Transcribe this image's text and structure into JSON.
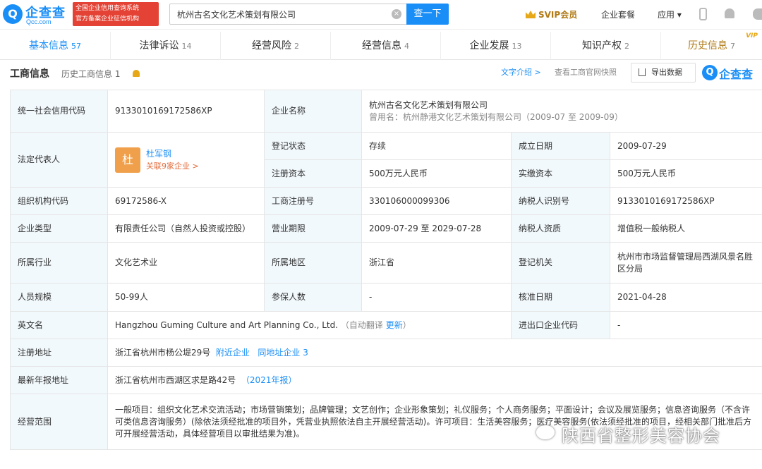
{
  "header": {
    "logo_glyph": "Q",
    "logo_text": "企查查",
    "logo_domain": "Qcc.com",
    "badge_line1": "全国企业信用查询系统",
    "badge_line2": "官方备案企业征信机构",
    "search_value": "杭州古名文化艺术策划有限公司",
    "clear_glyph": "×",
    "search_button": "查一下",
    "svip": "SVIP会员",
    "package": "企业套餐",
    "app": "应用 ▾"
  },
  "tabs": [
    {
      "label": "基本信息",
      "count": "57"
    },
    {
      "label": "法律诉讼",
      "count": "14"
    },
    {
      "label": "经营风险",
      "count": "2"
    },
    {
      "label": "经营信息",
      "count": "4"
    },
    {
      "label": "企业发展",
      "count": "13"
    },
    {
      "label": "知识产权",
      "count": "2"
    },
    {
      "label": "历史信息",
      "count": "7",
      "tag": "VIP"
    }
  ],
  "section": {
    "title": "工商信息",
    "history": "历史工商信息 1",
    "intro": "文字介绍 >",
    "gov": "查看工商官网快照",
    "export": "导出数据",
    "logo_text": "企查查"
  },
  "info": {
    "l_credit": "统一社会信用代码",
    "credit": "913301016917258­6XP",
    "l_name": "企业名称",
    "name": "杭州古名文化艺术策划有限公司",
    "former": "曾用名：杭州静港文化艺术策划有限公司（2009-07 至 2009-09）",
    "l_rep": "法定代表人",
    "rep_avatar": "杜",
    "rep_name": "杜军钢",
    "rep_link": "关联9家企业 >",
    "l_status": "登记状态",
    "status": "存续",
    "l_found": "成立日期",
    "found": "2009-07-29",
    "l_capital": "注册资本",
    "capital": "500万元人民币",
    "l_paid": "实缴资本",
    "paid": "500万元人民币",
    "l_org": "组织机构代码",
    "org": "69172586-X",
    "l_regno": "工商注册号",
    "regno": "330106000099306",
    "l_taxid": "纳税人识别号",
    "taxid": "91330101691725­86XP",
    "l_type": "企业类型",
    "type": "有限责任公司（自然人投资或控股）",
    "l_term": "营业期限",
    "term": "2009-07-29 至 2029-07-28",
    "l_taxq": "纳税人资质",
    "taxq": "增值税一般纳税人",
    "l_industry": "所属行业",
    "industry": "文化艺术业",
    "l_region": "所属地区",
    "region": "浙江省",
    "l_authority": "登记机关",
    "authority": "杭州市市场监督管理局西湖风景名胜区分局",
    "l_staff": "人员规模",
    "staff": "50-99人",
    "l_insured": "参保人数",
    "insured": "-",
    "l_approve": "核准日期",
    "approve": "2021-04-28",
    "l_en": "英文名",
    "en": "Hangzhou Guming Culture and Art Planning Co., Ltd.",
    "en_auto": "（自动翻译",
    "en_update": "更新",
    "en_close": "）",
    "l_impexp": "进出口企业代码",
    "impexp": "-",
    "l_addr": "注册地址",
    "addr": "浙江省杭州市杨公堤29号",
    "addr_near": "附近企业",
    "addr_same": "同地址企业 3",
    "l_annual": "最新年报地址",
    "annual": "浙江省杭州市西湖区求是路42号",
    "annual_year": "（2021年报）",
    "l_scope": "经营范围",
    "scope": "一般项目：组织文化艺术交流活动；市场营销策划；品牌管理；文艺创作；企业形象策划；礼仪服务；个人商务服务；平面设计；会议及展览服务；信息咨询服务（不含许可类信息咨询服务）(除依法须经批准的项目外，凭营业执照依法自主开展经营活动)。许可项目：生活美容服务；医疗美容服务(依法须经批准的项目，经相关部门批准后方可开展经营活动，具体经营项目以审批结果为准)。"
  },
  "watermark": "陕西省整形美容协会",
  "colors": {
    "accent": "#1a8ef7",
    "label_bg": "#f2f9fc",
    "vip": "#b07a16"
  }
}
